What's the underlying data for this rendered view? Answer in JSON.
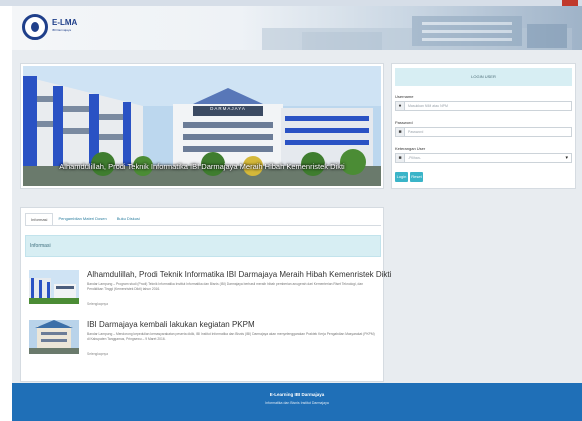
{
  "header": {
    "logo_text": "E-LMA",
    "logo_sub": "IBI Darmajaya"
  },
  "hero": {
    "caption": "Alhamdulillah, Prodi Teknik Informatika IBI Darmajaya Meraih Hibah Kemenristek Dikti",
    "building_sign": "DARMAJAYA"
  },
  "login": {
    "title": "LOGIN USER",
    "username_label": "Username",
    "username_placeholder": "Masukkan NIM atau NPM",
    "password_label": "Password",
    "password_placeholder": "Password",
    "role_label": "Keterangan User",
    "role_selected": "-Pilihan-",
    "login_button": "Login",
    "reset_button": "Reset"
  },
  "info": {
    "tabs": [
      "Informasi",
      "Pengambilan Materi Dosen",
      "Buku Diskusi"
    ],
    "banner": "Informasi",
    "news": [
      {
        "title": "Alhamdulillah, Prodi Teknik Informatika IBI Darmajaya Meraih Hibah Kemenristek Dikti",
        "desc": "Bandar Lampung – Program studi (Prodi) Teknik Informatika Institut Informatika dan Bisnis (IBI) Darmajaya berhasil meraih hibah pemberian anugerah dari Kementerian Riset Teknologi, dan Pendidikan Tinggi (Kemenristek Dikti) tahun 2016.",
        "more": "Selengkapnya"
      },
      {
        "title": "IBI Darmajaya kembali lakukan kegiatan PKPM",
        "desc": "Bandar Lampung – Mendorong kepedulian kemasyarakatan peserta didik, IBI Institut Informatika dan Bisnis (IBI) Darmajaya akan menyelenggarakan Praktek Kerja Pengabdian Masyarakat (PKPM) di Kabupaten Tanggamus, Pringsewu – 9 Maret 2016.",
        "more": "Selengkapnya"
      }
    ]
  },
  "footer": {
    "title": "E-Learning IBI Darmajaya",
    "subtitle": "Informatika dan Bisnis Institut Darmajaya"
  },
  "colors": {
    "accent": "#3ab4c8",
    "footer": "#1f6fb7",
    "banner": "#d7eef3",
    "brand": "#1f3f8a"
  },
  "icons": {
    "username": "user-icon",
    "password": "lock-icon",
    "role": "lock-icon",
    "select": "caret-down-icon"
  }
}
